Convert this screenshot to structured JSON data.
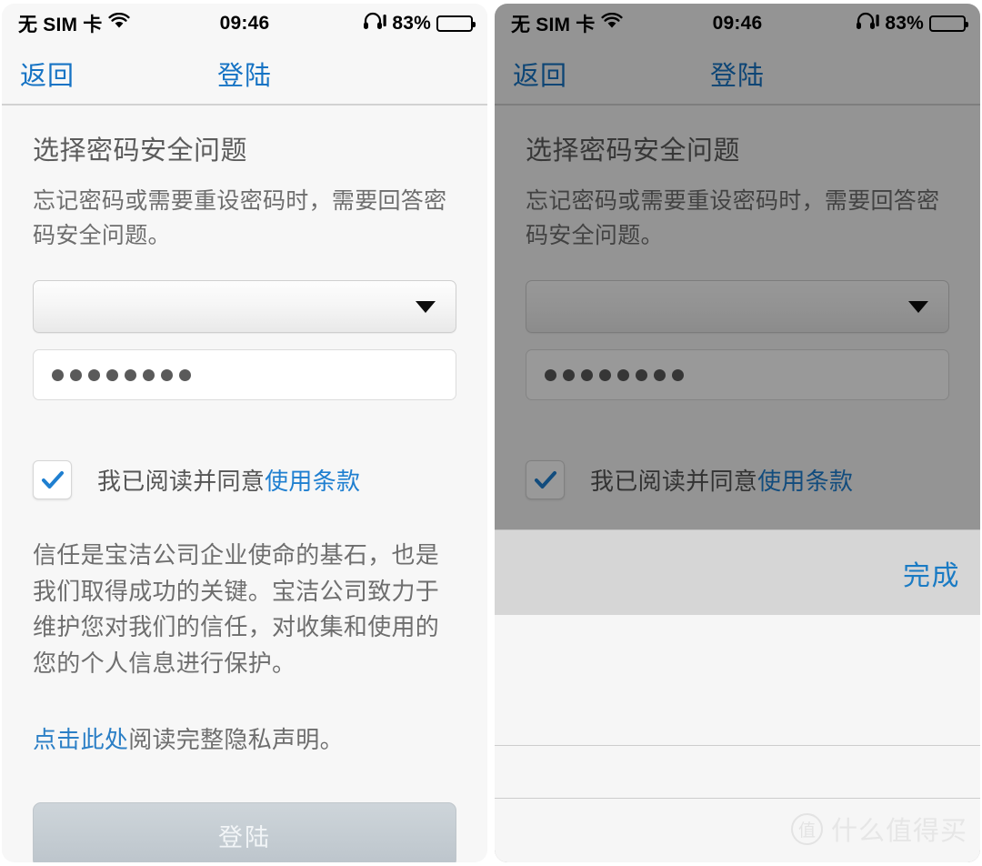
{
  "status_bar": {
    "carrier": "无 SIM 卡",
    "wifi_icon": "wifi-icon",
    "time": "09:46",
    "headphones_icon": "headphones-icon",
    "battery_percent": "83%",
    "battery_level": 83,
    "battery_icon": "battery-icon"
  },
  "nav": {
    "back_label": "返回",
    "title": "登陆",
    "accent_color": "#1673c4"
  },
  "form": {
    "heading": "选择密码安全问题",
    "description": "忘记密码或需要重设密码时，需要回答密码安全问题。",
    "security_question_select": {
      "value": "",
      "placeholder": "",
      "caret_icon": "chevron-down-icon"
    },
    "answer_field": {
      "masked_value": "●●●●●●●●",
      "dot_count": 8
    }
  },
  "agreement": {
    "checked": true,
    "check_icon": "checkmark-icon",
    "label_prefix": "我已阅读并同意",
    "link_label": "使用条款",
    "link_color": "#1f7fd0"
  },
  "privacy": {
    "paragraph": "信任是宝洁公司企业使命的基石，也是我们取得成功的关键。宝洁公司致力于维护您对我们的信任，对收集和使用的您的个人信息进行保护。",
    "link_label": "点击此处",
    "link_suffix": "阅读完整隐私声明。",
    "link_color": "#2b7fc6"
  },
  "submit": {
    "label": "登陆",
    "enabled": false
  },
  "picker": {
    "done_label": "完成",
    "done_color": "#1a7bc4",
    "options": [],
    "selected_value": ""
  },
  "watermark": {
    "badge": "值",
    "text": "什么值得买"
  }
}
